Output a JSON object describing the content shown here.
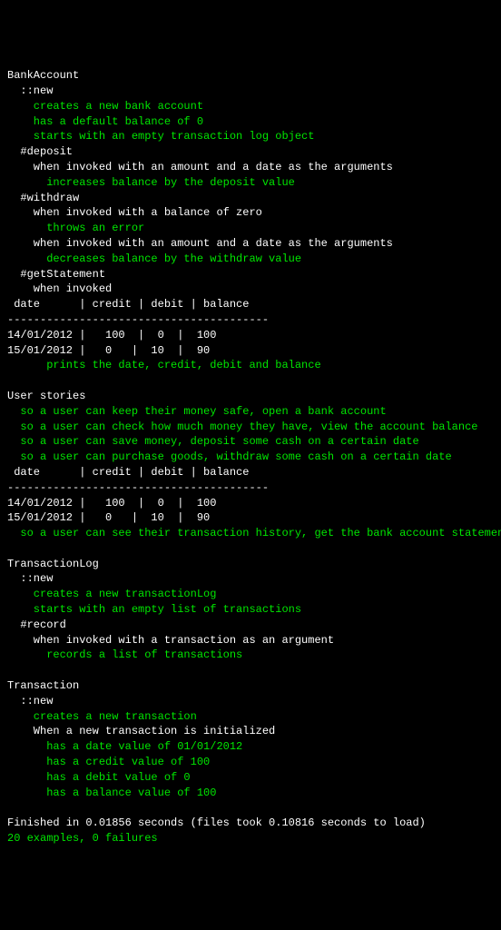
{
  "lines": [
    {
      "text": "BankAccount",
      "color": "white",
      "indent": 0
    },
    {
      "text": "::new",
      "color": "white",
      "indent": 1
    },
    {
      "text": "creates a new bank account",
      "color": "green",
      "indent": 2
    },
    {
      "text": "has a default balance of 0",
      "color": "green",
      "indent": 2
    },
    {
      "text": "starts with an empty transaction log object",
      "color": "green",
      "indent": 2
    },
    {
      "text": "#deposit",
      "color": "white",
      "indent": 1
    },
    {
      "text": "when invoked with an amount and a date as the arguments",
      "color": "white",
      "indent": 2
    },
    {
      "text": "increases balance by the deposit value",
      "color": "green",
      "indent": 3
    },
    {
      "text": "#withdraw",
      "color": "white",
      "indent": 1
    },
    {
      "text": "when invoked with a balance of zero",
      "color": "white",
      "indent": 2
    },
    {
      "text": "throws an error",
      "color": "green",
      "indent": 3
    },
    {
      "text": "when invoked with an amount and a date as the arguments",
      "color": "white",
      "indent": 2
    },
    {
      "text": "decreases balance by the withdraw value",
      "color": "green",
      "indent": 3
    },
    {
      "text": "#getStatement",
      "color": "white",
      "indent": 1
    },
    {
      "text": "when invoked",
      "color": "white",
      "indent": 2
    },
    {
      "text": " date      | credit | debit | balance",
      "color": "white",
      "indent": 0
    },
    {
      "text": "----------------------------------------",
      "color": "white",
      "indent": 0
    },
    {
      "text": "14/01/2012 |   100  |  0  |  100",
      "color": "white",
      "indent": 0
    },
    {
      "text": "15/01/2012 |   0   |  10  |  90",
      "color": "white",
      "indent": 0
    },
    {
      "text": "prints the date, credit, debit and balance",
      "color": "green",
      "indent": 3
    },
    {
      "text": "",
      "color": "white",
      "indent": 0
    },
    {
      "text": "User stories",
      "color": "white",
      "indent": 0
    },
    {
      "text": "so a user can keep their money safe, open a bank account",
      "color": "green",
      "indent": 1
    },
    {
      "text": "so a user can check how much money they have, view the account balance",
      "color": "green",
      "indent": 1
    },
    {
      "text": "so a user can save money, deposit some cash on a certain date",
      "color": "green",
      "indent": 1
    },
    {
      "text": "so a user can purchase goods, withdraw some cash on a certain date",
      "color": "green",
      "indent": 1
    },
    {
      "text": " date      | credit | debit | balance",
      "color": "white",
      "indent": 0
    },
    {
      "text": "----------------------------------------",
      "color": "white",
      "indent": 0
    },
    {
      "text": "14/01/2012 |   100  |  0  |  100",
      "color": "white",
      "indent": 0
    },
    {
      "text": "15/01/2012 |   0   |  10  |  90",
      "color": "white",
      "indent": 0
    },
    {
      "text": "so a user can see their transaction history, get the bank account statement",
      "color": "green",
      "indent": 1
    },
    {
      "text": "",
      "color": "white",
      "indent": 0
    },
    {
      "text": "TransactionLog",
      "color": "white",
      "indent": 0
    },
    {
      "text": "::new",
      "color": "white",
      "indent": 1
    },
    {
      "text": "creates a new transactionLog",
      "color": "green",
      "indent": 2
    },
    {
      "text": "starts with an empty list of transactions",
      "color": "green",
      "indent": 2
    },
    {
      "text": "#record",
      "color": "white",
      "indent": 1
    },
    {
      "text": "when invoked with a transaction as an argument",
      "color": "white",
      "indent": 2
    },
    {
      "text": "records a list of transactions",
      "color": "green",
      "indent": 3
    },
    {
      "text": "",
      "color": "white",
      "indent": 0
    },
    {
      "text": "Transaction",
      "color": "white",
      "indent": 0
    },
    {
      "text": "::new",
      "color": "white",
      "indent": 1
    },
    {
      "text": "creates a new transaction",
      "color": "green",
      "indent": 2
    },
    {
      "text": "When a new transaction is initialized",
      "color": "white",
      "indent": 2
    },
    {
      "text": "has a date value of 01/01/2012",
      "color": "green",
      "indent": 3
    },
    {
      "text": "has a credit value of 100",
      "color": "green",
      "indent": 3
    },
    {
      "text": "has a debit value of 0",
      "color": "green",
      "indent": 3
    },
    {
      "text": "has a balance value of 100",
      "color": "green",
      "indent": 3
    },
    {
      "text": "",
      "color": "white",
      "indent": 0
    },
    {
      "text": "Finished in 0.01856 seconds (files took 0.10816 seconds to load)",
      "color": "white",
      "indent": 0
    },
    {
      "text": "20 examples, 0 failures",
      "color": "green",
      "indent": 0
    }
  ]
}
